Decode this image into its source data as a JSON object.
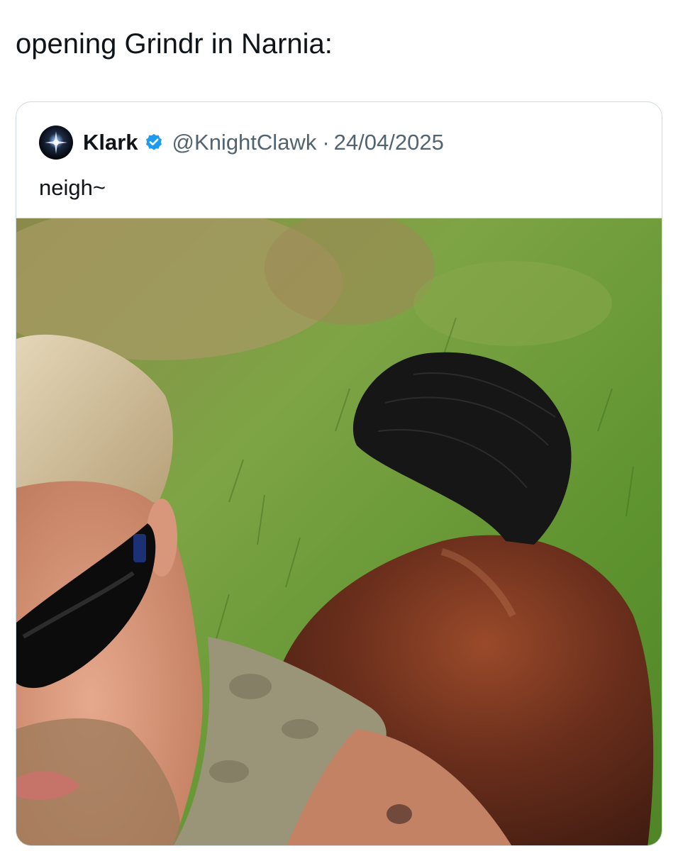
{
  "post": {
    "text": "opening Grindr in Narnia:"
  },
  "quoted_tweet": {
    "display_name": "Klark",
    "verified": true,
    "handle": "@KnightClawk",
    "separator": "·",
    "date": "24/04/2025",
    "text": "neigh~",
    "avatar_icon": "avatar-starburst-icon",
    "verified_icon": "verified-badge-icon",
    "verified_color": "#1d9bf0"
  },
  "colors": {
    "text_primary": "#0f1419",
    "text_secondary": "#536471",
    "border": "#cfd9de",
    "grass": "#6f9b3a",
    "horse_coat": "#6b2f1c",
    "tail": "#151515"
  }
}
